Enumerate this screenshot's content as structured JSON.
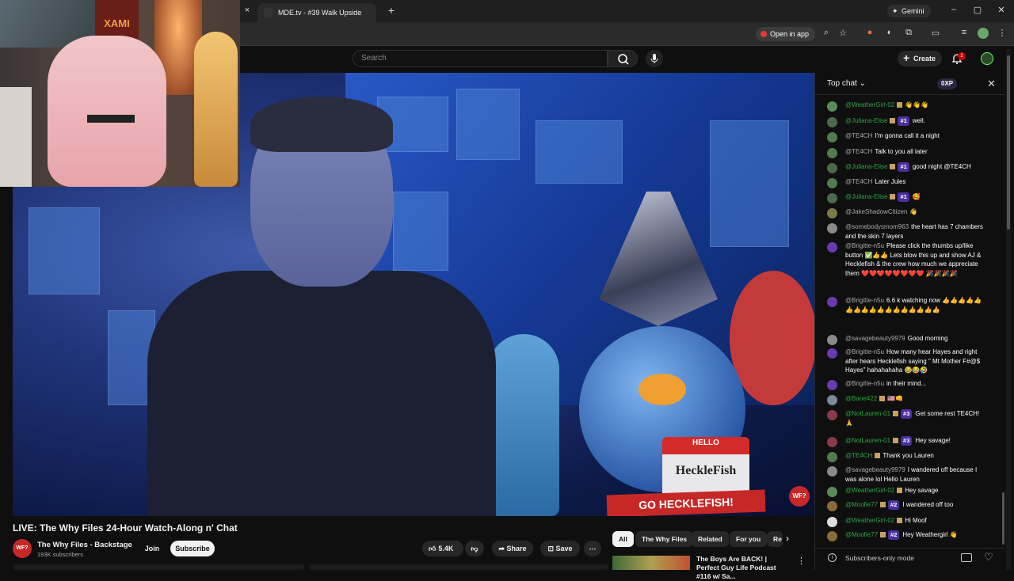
{
  "browser": {
    "tab_title": "MDE.tv - #39 Walk Upside",
    "gemini_label": "Gemini",
    "open_in_app": "Open in app",
    "new_tab": "+",
    "close_tab": "×"
  },
  "youtube": {
    "search_placeholder": "Search",
    "create_label": "Create",
    "notification_count": "2"
  },
  "video": {
    "hello_top": "HELLO",
    "hello_name": "HeckleFish",
    "sign_text": "GO HECKLEFISH!",
    "watermark": "WF?",
    "webcam_poster_text": "XAMI"
  },
  "info": {
    "title": "LIVE: The Why Files 24-Hour Watch-Along n' Chat",
    "channel_name": "The Why Files - Backstage",
    "channel_avatar": "WF?",
    "subscribers": "193K subscribers",
    "join_label": "Join",
    "subscribe_label": "Subscribe",
    "like_count": "5.4K",
    "share_label": "Share",
    "save_label": "Save"
  },
  "chips": [
    "All",
    "The Why Files",
    "Related",
    "For you",
    "Re"
  ],
  "recommendation": {
    "title": "The Boys Are BACK! | Perfect Guy Life Podcast #116 w/ Sa..."
  },
  "chat": {
    "header": "Top chat",
    "xp": "0XP",
    "subscribers_only": "Subscribers-only mode",
    "messages": [
      {
        "author": "@WeatherGirl-02",
        "text": "👋👋👋",
        "color": "green"
      },
      {
        "author": "@Juliana-Elise",
        "badge": "#1",
        "text": "well.",
        "color": "green"
      },
      {
        "author": "@TE4CH",
        "text": "I'm gonna call it a night",
        "color": "gray"
      },
      {
        "author": "@TE4CH",
        "text": "Talk to you all later",
        "color": "gray"
      },
      {
        "author": "@Juliana-Elise",
        "badge": "#1",
        "text": "good night @TE4CH",
        "color": "green"
      },
      {
        "author": "@TE4CH",
        "text": "Later Jules",
        "color": "gray"
      },
      {
        "author": "@Juliana-Elise",
        "badge": "#1",
        "text": "🥰",
        "color": "green"
      },
      {
        "author": "@JakeShadowCitizen",
        "text": "👋",
        "color": "gray"
      },
      {
        "author": "@somebodysmom963",
        "text": "the heart has 7 chambers and the skin 7 layers",
        "color": "gray"
      },
      {
        "author": "@Brigitte-n5u",
        "text": "Please click the thumbs up/like button ✅👍👍 Lets blow this up and show AJ & Hecklefish & the crew how much we appreciate them ❤️❤️❤️❤️❤️❤️❤️❤️ 🎉🎉🎉🎉",
        "color": "gray"
      },
      {
        "author": "@Brigitte-n5u",
        "text": "6.6 k watching now 👍👍👍👍👍👍👍👍👍👍👍👍👍👍👍👍👍",
        "color": "gray"
      },
      {
        "author": "@savagebeauty9979",
        "text": "Good morning",
        "color": "gray"
      },
      {
        "author": "@Brigitte-n5u",
        "text": "How many hear Hayes and right after hears Hecklefish saying \" Mt Mother F#@$ Hayes\" hahahahaha 😂😂🤣",
        "color": "gray"
      },
      {
        "author": "@Brigitte-n5u",
        "text": "in their mind...",
        "color": "gray"
      },
      {
        "author": "@Bane422",
        "text": "🇺🇸👊",
        "color": "green"
      },
      {
        "author": "@NotLauren-01",
        "badge": "#3",
        "text": "Get some rest TE4CH! 🙏",
        "color": "green"
      },
      {
        "author": "@NotLauren-01",
        "badge": "#3",
        "text": "Hey savage!",
        "color": "green"
      },
      {
        "author": "@TE4CH",
        "text": "Thank you Lauren",
        "color": "green"
      },
      {
        "author": "@savagebeauty9979",
        "text": "I wandered off because I was alone lol Hello Lauren",
        "color": "gray"
      },
      {
        "author": "@WeatherGirl-02",
        "text": "Hey savage",
        "color": "green"
      },
      {
        "author": "@Moofie77",
        "badge": "#2",
        "text": "I wandered off too",
        "color": "green"
      },
      {
        "author": "@WeatherGirl-02",
        "text": "Hi Moof",
        "color": "green"
      },
      {
        "author": "@Moofie77",
        "badge": "#2",
        "text": "Hey Weathergirl 👋",
        "color": "green"
      }
    ]
  }
}
